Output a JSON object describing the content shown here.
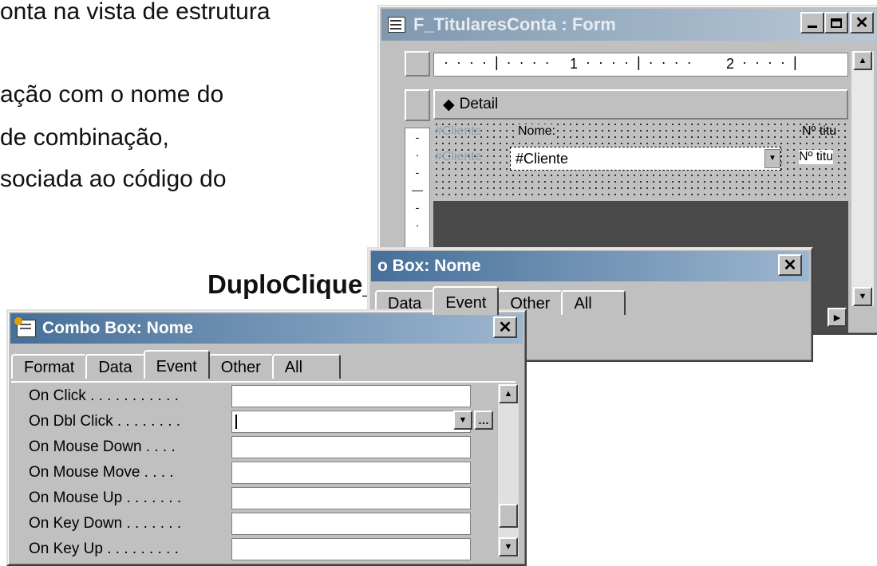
{
  "slide": {
    "line1": "onta na vista de estrutura",
    "line2": "ação com o nome do",
    "line3": " de combinação,",
    "line4": "sociada ao código do",
    "macro": "DuploClique_Cliente"
  },
  "form_window": {
    "title": "F_TitularesConta : Form",
    "section": "Detail",
    "ruler_marks": [
      "1",
      "2"
    ],
    "header_label1": "#Cliente",
    "header_label2": "Nome:",
    "header_label3": "Nº titu",
    "row_label": "#Cliente",
    "combo_value": "#Cliente",
    "row_right": "Nº titu"
  },
  "back_props": {
    "title": "o Box: Nome",
    "tabs": [
      "Data",
      "Event",
      "Other",
      "All"
    ]
  },
  "props": {
    "title": "Combo Box: Nome",
    "tabs": [
      "Format",
      "Data",
      "Event",
      "Other",
      "All"
    ],
    "active_tab": "Event",
    "rows": [
      {
        "label": "On Click . . . . . . . . . . ."
      },
      {
        "label": "On Dbl Click . . . . . . . ."
      },
      {
        "label": "On Mouse Down . . . ."
      },
      {
        "label": "On Mouse Move . . . ."
      },
      {
        "label": "On Mouse Up . . . . . . ."
      },
      {
        "label": "On Key Down . . . . . . ."
      },
      {
        "label": "On Key Up . . . . . . . . ."
      }
    ]
  },
  "icons": {
    "close": "close-icon",
    "minimize": "minimize-icon",
    "maximize": "maximize-icon"
  }
}
